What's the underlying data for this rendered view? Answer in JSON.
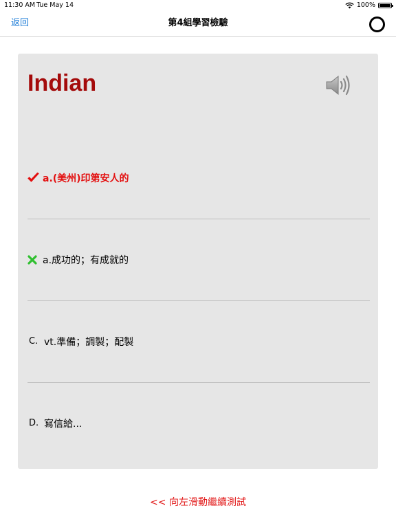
{
  "status_bar": {
    "time": "11:30 AM",
    "date": "Tue May 14",
    "battery": "100%",
    "battery_level": 1.0
  },
  "nav": {
    "back_label": "返回",
    "title": "第4組學習檢驗"
  },
  "card": {
    "word": "Indian",
    "options": [
      {
        "marker": "check",
        "text": "a.(美州)印第安人的"
      },
      {
        "marker": "cross",
        "text": "a.成功的；有成就的"
      },
      {
        "marker": "C.",
        "text": "vt.準備；調製；配製"
      },
      {
        "marker": "D.",
        "text": "寫信給..."
      }
    ]
  },
  "swipe_hint": "<< 向左滑動繼續測試",
  "colors": {
    "word": "#a40b0b",
    "correct": "#e30f0f",
    "wrong_mark": "#2fbf2f",
    "link": "#1a7bd7",
    "card_bg": "#e6e6e6"
  }
}
